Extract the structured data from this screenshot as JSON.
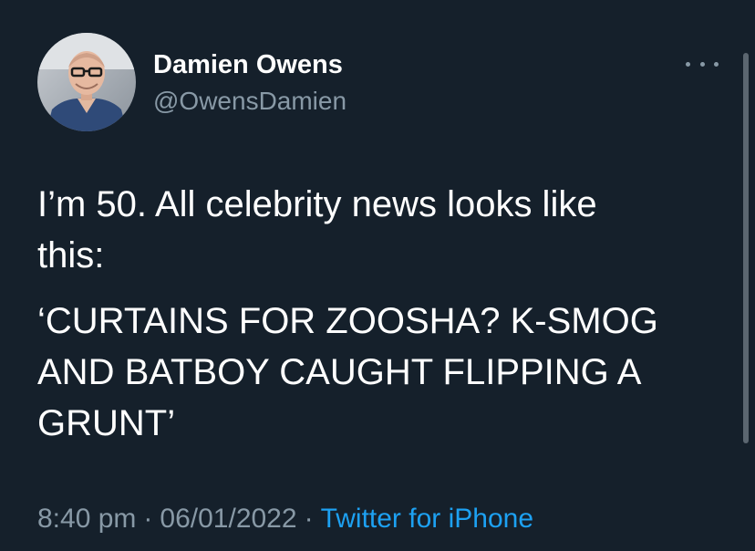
{
  "author": {
    "display_name": "Damien Owens",
    "handle": "@OwensDamien"
  },
  "more_icon": "more-horizontal-icon",
  "tweet": {
    "paragraphs": [
      "I’m 50. All celebrity news looks like\nthis:",
      "‘CURTAINS FOR ZOOSHA? K-SMOG\nAND BATBOY CAUGHT FLIPPING A\nGRUNT’"
    ]
  },
  "meta": {
    "time": "8:40 pm",
    "separator": "·",
    "date": "06/01/2022",
    "source": "Twitter for iPhone"
  },
  "colors": {
    "background": "#15202b",
    "primary_text": "#ffffff",
    "secondary_text": "#8899a6",
    "link": "#1da1f2"
  }
}
